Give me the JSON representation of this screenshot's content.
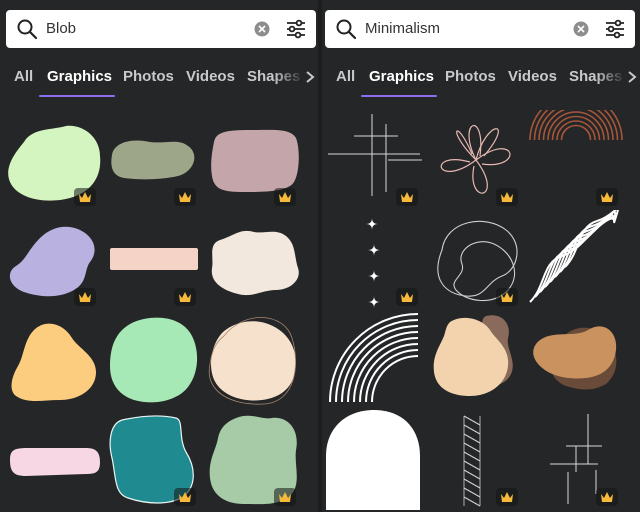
{
  "panels": [
    {
      "search": {
        "query": "Blob",
        "search_icon": "search-icon",
        "clear_icon": "clear-icon",
        "filter_icon": "filter-icon"
      },
      "tabs": [
        {
          "label": "All",
          "active": false
        },
        {
          "label": "Graphics",
          "active": true
        },
        {
          "label": "Photos",
          "active": false
        },
        {
          "label": "Videos",
          "active": false
        },
        {
          "label": "Shapes",
          "active": false
        }
      ],
      "results": [
        {
          "name": "green-blob",
          "color": "#d4f5bf",
          "premium": true
        },
        {
          "name": "olive-blob",
          "color": "#9ea68a",
          "premium": true
        },
        {
          "name": "mauve-blob",
          "color": "#c4a6aa",
          "premium": true
        },
        {
          "name": "lavender-blob",
          "color": "#b9b2e1",
          "premium": true
        },
        {
          "name": "peach-bar",
          "color": "#f5d4c7",
          "premium": true
        },
        {
          "name": "cream-blob",
          "color": "#f2e8de",
          "premium": false
        },
        {
          "name": "yellow-blob",
          "color": "#fdcd7f",
          "premium": false
        },
        {
          "name": "mint-blob",
          "color": "#a6e8b6",
          "premium": false
        },
        {
          "name": "outline-cream-blob",
          "color": "#f6e2cc",
          "premium": false
        },
        {
          "name": "pink-bar",
          "color": "#f6d7e3",
          "premium": false
        },
        {
          "name": "teal-blob",
          "color": "#1f8a8f",
          "premium": true
        },
        {
          "name": "sage-blob",
          "color": "#a6cba6",
          "premium": true
        }
      ]
    },
    {
      "search": {
        "query": "Minimalism",
        "search_icon": "search-icon",
        "clear_icon": "clear-icon",
        "filter_icon": "filter-icon"
      },
      "tabs": [
        {
          "label": "All",
          "active": false
        },
        {
          "label": "Graphics",
          "active": true
        },
        {
          "label": "Photos",
          "active": false
        },
        {
          "label": "Videos",
          "active": false
        },
        {
          "label": "Shapes",
          "active": false
        }
      ],
      "results": [
        {
          "name": "cross-lines",
          "color": "#d8d8d8",
          "premium": true
        },
        {
          "name": "loop-flower",
          "color": "#e6b8b2",
          "premium": true
        },
        {
          "name": "rainbow-arcs",
          "color": "#a4563a",
          "premium": true
        },
        {
          "name": "sparkles",
          "color": "#ffffff",
          "premium": true
        },
        {
          "name": "outline-blobs",
          "color": "#cfcfcf",
          "premium": true
        },
        {
          "name": "wave-stripes",
          "color": "#ffffff",
          "premium": false
        },
        {
          "name": "white-arcs",
          "color": "#ffffff",
          "premium": false
        },
        {
          "name": "peach-blob-shadow",
          "color": "#f3d3ae",
          "premium": false
        },
        {
          "name": "tan-blob-shadow",
          "color": "#c9925e",
          "premium": false
        },
        {
          "name": "white-arch",
          "color": "#ffffff",
          "premium": false
        },
        {
          "name": "diagonal-hatch",
          "color": "#d0d0d0",
          "premium": true
        },
        {
          "name": "step-lines",
          "color": "#d8d8d8",
          "premium": true
        }
      ]
    }
  ]
}
